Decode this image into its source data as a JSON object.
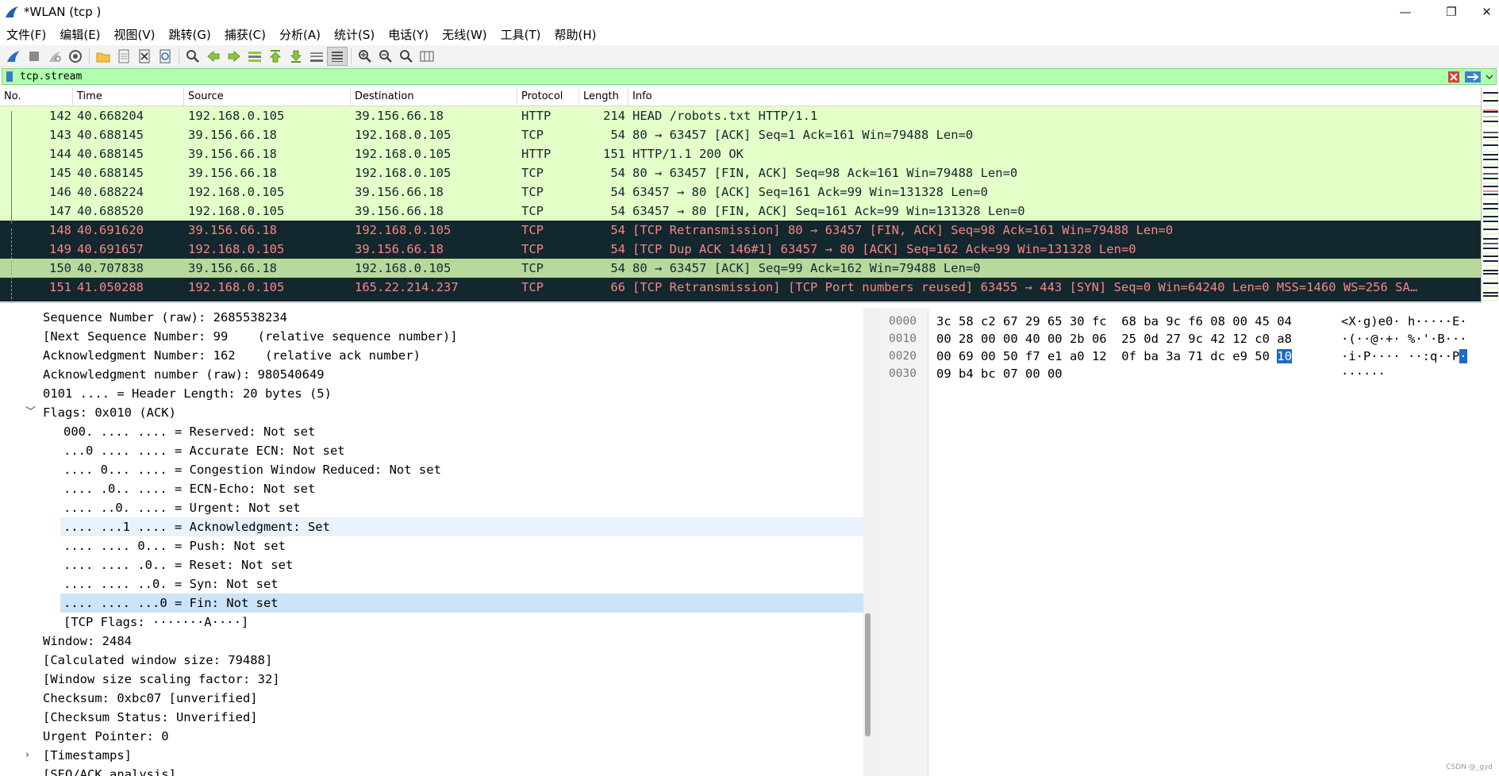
{
  "window": {
    "title": "*WLAN (tcp )",
    "minimize_glyph": "—",
    "maximize_glyph": "❐",
    "close_glyph": "✕"
  },
  "menu": [
    "文件(F)",
    "编辑(E)",
    "视图(V)",
    "跳转(G)",
    "捕获(C)",
    "分析(A)",
    "统计(S)",
    "电话(Y)",
    "无线(W)",
    "工具(T)",
    "帮助(H)"
  ],
  "toolbar_icons": [
    "shark-fin-start-icon",
    "stop-capture-icon",
    "restart-capture-icon",
    "capture-options-icon",
    "open-file-icon",
    "save-file-icon",
    "close-file-icon",
    "reload-file-icon",
    "find-packet-icon",
    "go-back-icon",
    "go-forward-icon",
    "go-to-packet-icon",
    "go-first-icon",
    "go-last-icon",
    "auto-scroll-icon",
    "colorize-icon",
    "zoom-in-icon",
    "zoom-out-icon",
    "zoom-normal-icon",
    "resize-columns-icon"
  ],
  "filter": {
    "value": "tcp.stream",
    "bg_color": "#afffaf"
  },
  "packet_list": {
    "columns": [
      "No.",
      "Time",
      "Source",
      "Destination",
      "Protocol",
      "Length",
      "Info"
    ],
    "rows": [
      {
        "no": "142",
        "time": "40.668204",
        "src": "192.168.0.105",
        "dst": "39.156.66.18",
        "proto": "HTTP",
        "len": "214",
        "info": "HEAD /robots.txt HTTP/1.1",
        "style": "green"
      },
      {
        "no": "143",
        "time": "40.688145",
        "src": "39.156.66.18",
        "dst": "192.168.0.105",
        "proto": "TCP",
        "len": "54",
        "info": "80 → 63457 [ACK] Seq=1 Ack=161 Win=79488 Len=0",
        "style": "green"
      },
      {
        "no": "144",
        "time": "40.688145",
        "src": "39.156.66.18",
        "dst": "192.168.0.105",
        "proto": "HTTP",
        "len": "151",
        "info": "HTTP/1.1 200 OK",
        "style": "green"
      },
      {
        "no": "145",
        "time": "40.688145",
        "src": "39.156.66.18",
        "dst": "192.168.0.105",
        "proto": "TCP",
        "len": "54",
        "info": "80 → 63457 [FIN, ACK] Seq=98 Ack=161 Win=79488 Len=0",
        "style": "green"
      },
      {
        "no": "146",
        "time": "40.688224",
        "src": "192.168.0.105",
        "dst": "39.156.66.18",
        "proto": "TCP",
        "len": "54",
        "info": "63457 → 80 [ACK] Seq=161 Ack=99 Win=131328 Len=0",
        "style": "green"
      },
      {
        "no": "147",
        "time": "40.688520",
        "src": "192.168.0.105",
        "dst": "39.156.66.18",
        "proto": "TCP",
        "len": "54",
        "info": "63457 → 80 [FIN, ACK] Seq=161 Ack=99 Win=131328 Len=0",
        "style": "green"
      },
      {
        "no": "148",
        "time": "40.691620",
        "src": "39.156.66.18",
        "dst": "192.168.0.105",
        "proto": "TCP",
        "len": "54",
        "info": "[TCP Retransmission] 80 → 63457 [FIN, ACK] Seq=98 Ack=161 Win=79488 Len=0",
        "style": "dark"
      },
      {
        "no": "149",
        "time": "40.691657",
        "src": "192.168.0.105",
        "dst": "39.156.66.18",
        "proto": "TCP",
        "len": "54",
        "info": "[TCP Dup ACK 146#1] 63457 → 80 [ACK] Seq=162 Ack=99 Win=131328 Len=0",
        "style": "dark"
      },
      {
        "no": "150",
        "time": "40.707838",
        "src": "39.156.66.18",
        "dst": "192.168.0.105",
        "proto": "TCP",
        "len": "54",
        "info": "80 → 63457 [ACK] Seq=99 Ack=162 Win=79488 Len=0",
        "style": "selgreen"
      },
      {
        "no": "151",
        "time": "41.050288",
        "src": "192.168.0.105",
        "dst": "165.22.214.237",
        "proto": "TCP",
        "len": "66",
        "info": "[TCP Retransmission] [TCP Port numbers reused] 63455 → 443 [SYN] Seq=0 Win=64240 Len=0 MSS=1460 WS=256 SA…",
        "style": "dark"
      }
    ]
  },
  "details": [
    {
      "text": "Sequence Number (raw): 2685538234",
      "indent": 1
    },
    {
      "text": "[Next Sequence Number: 99    (relative sequence number)]",
      "indent": 1
    },
    {
      "text": "Acknowledgment Number: 162    (relative ack number)",
      "indent": 1
    },
    {
      "text": "Acknowledgment number (raw): 980540649",
      "indent": 1
    },
    {
      "text": "0101 .... = Header Length: 20 bytes (5)",
      "indent": 1
    },
    {
      "text": "Flags: 0x010 (ACK)",
      "indent": 1,
      "arrow": "﹀"
    },
    {
      "text": "000. .... .... = Reserved: Not set",
      "indent": 2
    },
    {
      "text": "...0 .... .... = Accurate ECN: Not set",
      "indent": 2
    },
    {
      "text": ".... 0... .... = Congestion Window Reduced: Not set",
      "indent": 2
    },
    {
      "text": ".... .0.. .... = ECN-Echo: Not set",
      "indent": 2
    },
    {
      "text": ".... ..0. .... = Urgent: Not set",
      "indent": 2
    },
    {
      "text": ".... ...1 .... = Acknowledgment: Set",
      "indent": 2,
      "hl": "light"
    },
    {
      "text": ".... .... 0... = Push: Not set",
      "indent": 2
    },
    {
      "text": ".... .... .0.. = Reset: Not set",
      "indent": 2
    },
    {
      "text": ".... .... ..0. = Syn: Not set",
      "indent": 2
    },
    {
      "text": ".... .... ...0 = Fin: Not set",
      "indent": 2,
      "hl": "sel"
    },
    {
      "text": "[TCP Flags: ·······A····]",
      "indent": 2
    },
    {
      "text": "Window: 2484",
      "indent": 1
    },
    {
      "text": "[Calculated window size: 79488]",
      "indent": 1
    },
    {
      "text": "[Window size scaling factor: 32]",
      "indent": 1
    },
    {
      "text": "Checksum: 0xbc07 [unverified]",
      "indent": 1
    },
    {
      "text": "[Checksum Status: Unverified]",
      "indent": 1
    },
    {
      "text": "Urgent Pointer: 0",
      "indent": 1
    },
    {
      "text": "[Timestamps]",
      "indent": 1,
      "arrow": "›"
    },
    {
      "text": "[SEQ/ACK analysis]",
      "indent": 1
    }
  ],
  "bytes": [
    {
      "offset": "0000",
      "hex": "3c 58 c2 67 29 65 30 fc  68 ba 9c f6 08 00 45 04",
      "ascii": "<X·g)e0· h·····E·"
    },
    {
      "offset": "0010",
      "hex": "00 28 00 00 40 00 2b 06  25 0d 27 9c 42 12 c0 a8",
      "ascii": "·(··@·+· %·'·B···"
    },
    {
      "offset": "0020",
      "hex": "00 69 00 50 f7 e1 a0 12  0f ba 3a 71 dc e9 50 ",
      "hex_sel": "10",
      "ascii": "·i·P···· ··:q··P",
      "ascii_sel": "·"
    },
    {
      "offset": "0030",
      "hex": "09 b4 bc 07 00 00",
      "ascii": "······"
    }
  ],
  "watermark": "CSDN @_gyd"
}
